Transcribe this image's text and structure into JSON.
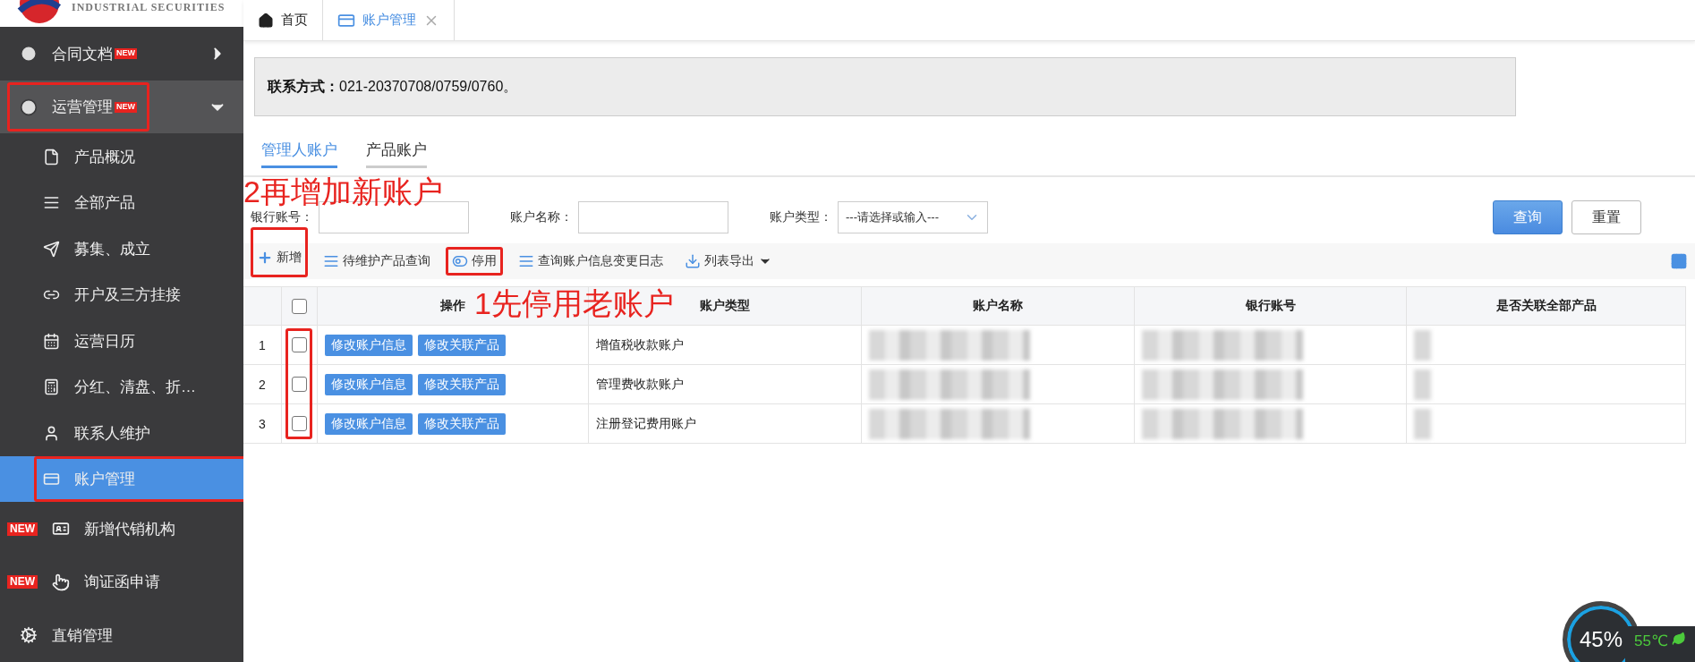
{
  "logo": {
    "subtitle": "INDUSTRIAL SECURITIES"
  },
  "sidebar": {
    "items": [
      {
        "label": "合同文档",
        "new_badge": "NEW",
        "expanded": false,
        "selected": false,
        "highlighted": false
      },
      {
        "label": "运营管理",
        "new_badge": "NEW",
        "expanded": true,
        "selected": false,
        "highlighted": true,
        "children": [
          {
            "label": "产品概况",
            "selected": false,
            "highlighted": false
          },
          {
            "label": "全部产品",
            "selected": false,
            "highlighted": false
          },
          {
            "label": "募集、成立",
            "selected": false,
            "highlighted": false
          },
          {
            "label": "开户及三方挂接",
            "selected": false,
            "highlighted": false
          },
          {
            "label": "运营日历",
            "selected": false,
            "highlighted": false
          },
          {
            "label": "分红、清盘、折…",
            "selected": false,
            "highlighted": false
          },
          {
            "label": "联系人维护",
            "selected": false,
            "highlighted": false
          },
          {
            "label": "账户管理",
            "selected": true,
            "highlighted": true
          }
        ]
      },
      {
        "label": "新增代销机构",
        "prefix_badge": "NEW",
        "selected": false,
        "highlighted": false
      },
      {
        "label": "询证函申请",
        "prefix_badge": "NEW",
        "selected": false,
        "highlighted": false
      },
      {
        "label": "直销管理",
        "selected": false,
        "highlighted": false
      }
    ]
  },
  "page_tabs": [
    {
      "label": "首页",
      "selected": false,
      "closable": false
    },
    {
      "label": "账户管理",
      "selected": true,
      "closable": true
    }
  ],
  "contact": {
    "label": "联系方式：",
    "value": "021-20370708/0759/0760。"
  },
  "account_tabs": [
    {
      "label": "管理人账户",
      "selected": true
    },
    {
      "label": "产品账户",
      "selected": false
    }
  ],
  "filters": [
    {
      "kind": "input",
      "label": "银行账号："
    },
    {
      "kind": "input",
      "label": "账户名称："
    },
    {
      "kind": "select",
      "label": "账户类型：",
      "placeholder": "---请选择或输入---"
    }
  ],
  "buttons": [
    {
      "label": "查询",
      "primary": true
    },
    {
      "label": "重置",
      "primary": false
    }
  ],
  "toolbar": [
    {
      "label": "新增",
      "highlighted": true,
      "dropdown": false
    },
    {
      "label": "待维护产品查询",
      "highlighted": false,
      "dropdown": false
    },
    {
      "label": "停用",
      "highlighted": true,
      "dropdown": false
    },
    {
      "label": "查询账户信息变更日志",
      "highlighted": false,
      "dropdown": false
    },
    {
      "label": "列表导出",
      "highlighted": false,
      "dropdown": true
    }
  ],
  "table": {
    "columns": [
      "操作",
      "账户类型",
      "账户名称",
      "银行账号",
      "是否关联全部产品"
    ],
    "header_checked": false,
    "checkbox_column_highlighted": true,
    "rows": [
      {
        "number": "1",
        "checked": false,
        "actions": [
          "修改账户信息",
          "修改关联产品"
        ],
        "type": "增值税收款账户",
        "redacted": true
      },
      {
        "number": "2",
        "checked": false,
        "actions": [
          "修改账户信息",
          "修改关联产品"
        ],
        "type": "管理费收款账户",
        "redacted": true
      },
      {
        "number": "3",
        "checked": false,
        "actions": [
          "修改账户信息",
          "修改关联产品"
        ],
        "type": "注册登记费用账户",
        "redacted": true
      }
    ]
  },
  "annotations": [
    {
      "text": "2再增加新账户"
    },
    {
      "text": "1先停用老账户"
    }
  ],
  "system_widget": {
    "reading": "45%",
    "temperature": "55℃"
  }
}
